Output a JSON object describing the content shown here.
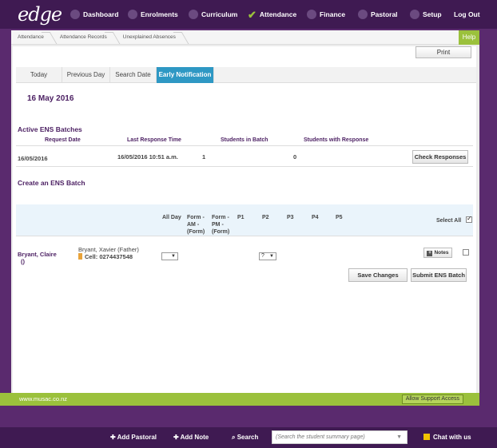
{
  "app": {
    "logo": "edge"
  },
  "nav": {
    "dashboard": "Dashboard",
    "enrolments": "Enrolments",
    "curriculum": "Curriculum",
    "attendance": "Attendance",
    "finance": "Finance",
    "pastoral": "Pastoral",
    "setup": "Setup",
    "logout": "Log Out"
  },
  "breadcrumb": [
    "Attendance",
    "Attendance Records",
    "Unexplained Absences"
  ],
  "help": "Help",
  "print": "Print",
  "tabs": [
    "Today",
    "Previous Day",
    "Search Date",
    "Early Notification"
  ],
  "date": "16 May 2016",
  "active": {
    "title": "Active ENS Batches",
    "headers": [
      "Request Date",
      "Last Response Time",
      "Students in Batch",
      "Students with Response"
    ],
    "row": {
      "request_date": "16/05/2016",
      "last_response": "16/05/2016 10:51 a.m.",
      "students": "1",
      "responses": "0"
    },
    "check_btn": "Check Responses"
  },
  "create": {
    "title": "Create an ENS Batch",
    "cols": {
      "all_day": "All Day",
      "form_am_1": "Form -",
      "form_am_2": "AM -",
      "form_am_3": "(Form)",
      "form_pm_1": "Form -",
      "form_pm_2": "PM -",
      "form_pm_3": "(Form)",
      "p1": "P1",
      "p2": "P2",
      "p3": "P3",
      "p4": "P4",
      "p5": "P5"
    },
    "select_all": "Select All",
    "student": {
      "name": "Bryant, Claire",
      "sub": "()",
      "contact": "Bryant, Xavier (Father)",
      "cell": "Cell: 0274437548",
      "all_day_value": "",
      "p2_value": "?"
    },
    "notes_btn": "Notes",
    "save_btn": "Save Changes",
    "submit_btn": "Submit ENS Batch"
  },
  "footer": {
    "url": "www.musac.co.nz",
    "support": "Allow Support Access"
  },
  "bottom": {
    "add_pastoral": "Add Pastoral",
    "add_note": "Add Note",
    "search": "Search",
    "search_placeholder": "(Search the student summary page)",
    "chat": "Chat with us"
  },
  "colors": {
    "nav": "#3f1a52",
    "accent": "#2e98c4",
    "brand_green": "#9bc13c",
    "heading": "#4b1f62"
  }
}
